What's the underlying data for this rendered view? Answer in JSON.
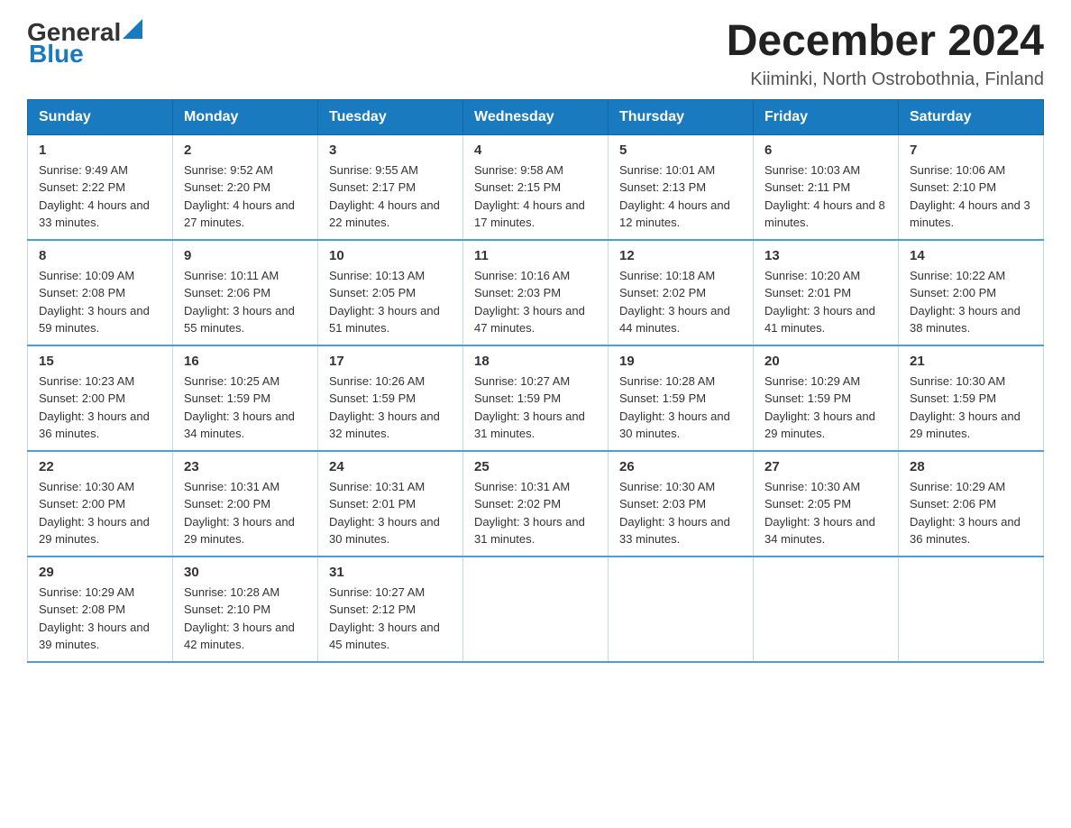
{
  "header": {
    "logo_general": "General",
    "logo_blue": "Blue",
    "title": "December 2024",
    "subtitle": "Kiiminki, North Ostrobothnia, Finland"
  },
  "days_of_week": [
    "Sunday",
    "Monday",
    "Tuesday",
    "Wednesday",
    "Thursday",
    "Friday",
    "Saturday"
  ],
  "weeks": [
    [
      {
        "day": "1",
        "sunrise": "9:49 AM",
        "sunset": "2:22 PM",
        "daylight": "4 hours and 33 minutes."
      },
      {
        "day": "2",
        "sunrise": "9:52 AM",
        "sunset": "2:20 PM",
        "daylight": "4 hours and 27 minutes."
      },
      {
        "day": "3",
        "sunrise": "9:55 AM",
        "sunset": "2:17 PM",
        "daylight": "4 hours and 22 minutes."
      },
      {
        "day": "4",
        "sunrise": "9:58 AM",
        "sunset": "2:15 PM",
        "daylight": "4 hours and 17 minutes."
      },
      {
        "day": "5",
        "sunrise": "10:01 AM",
        "sunset": "2:13 PM",
        "daylight": "4 hours and 12 minutes."
      },
      {
        "day": "6",
        "sunrise": "10:03 AM",
        "sunset": "2:11 PM",
        "daylight": "4 hours and 8 minutes."
      },
      {
        "day": "7",
        "sunrise": "10:06 AM",
        "sunset": "2:10 PM",
        "daylight": "4 hours and 3 minutes."
      }
    ],
    [
      {
        "day": "8",
        "sunrise": "10:09 AM",
        "sunset": "2:08 PM",
        "daylight": "3 hours and 59 minutes."
      },
      {
        "day": "9",
        "sunrise": "10:11 AM",
        "sunset": "2:06 PM",
        "daylight": "3 hours and 55 minutes."
      },
      {
        "day": "10",
        "sunrise": "10:13 AM",
        "sunset": "2:05 PM",
        "daylight": "3 hours and 51 minutes."
      },
      {
        "day": "11",
        "sunrise": "10:16 AM",
        "sunset": "2:03 PM",
        "daylight": "3 hours and 47 minutes."
      },
      {
        "day": "12",
        "sunrise": "10:18 AM",
        "sunset": "2:02 PM",
        "daylight": "3 hours and 44 minutes."
      },
      {
        "day": "13",
        "sunrise": "10:20 AM",
        "sunset": "2:01 PM",
        "daylight": "3 hours and 41 minutes."
      },
      {
        "day": "14",
        "sunrise": "10:22 AM",
        "sunset": "2:00 PM",
        "daylight": "3 hours and 38 minutes."
      }
    ],
    [
      {
        "day": "15",
        "sunrise": "10:23 AM",
        "sunset": "2:00 PM",
        "daylight": "3 hours and 36 minutes."
      },
      {
        "day": "16",
        "sunrise": "10:25 AM",
        "sunset": "1:59 PM",
        "daylight": "3 hours and 34 minutes."
      },
      {
        "day": "17",
        "sunrise": "10:26 AM",
        "sunset": "1:59 PM",
        "daylight": "3 hours and 32 minutes."
      },
      {
        "day": "18",
        "sunrise": "10:27 AM",
        "sunset": "1:59 PM",
        "daylight": "3 hours and 31 minutes."
      },
      {
        "day": "19",
        "sunrise": "10:28 AM",
        "sunset": "1:59 PM",
        "daylight": "3 hours and 30 minutes."
      },
      {
        "day": "20",
        "sunrise": "10:29 AM",
        "sunset": "1:59 PM",
        "daylight": "3 hours and 29 minutes."
      },
      {
        "day": "21",
        "sunrise": "10:30 AM",
        "sunset": "1:59 PM",
        "daylight": "3 hours and 29 minutes."
      }
    ],
    [
      {
        "day": "22",
        "sunrise": "10:30 AM",
        "sunset": "2:00 PM",
        "daylight": "3 hours and 29 minutes."
      },
      {
        "day": "23",
        "sunrise": "10:31 AM",
        "sunset": "2:00 PM",
        "daylight": "3 hours and 29 minutes."
      },
      {
        "day": "24",
        "sunrise": "10:31 AM",
        "sunset": "2:01 PM",
        "daylight": "3 hours and 30 minutes."
      },
      {
        "day": "25",
        "sunrise": "10:31 AM",
        "sunset": "2:02 PM",
        "daylight": "3 hours and 31 minutes."
      },
      {
        "day": "26",
        "sunrise": "10:30 AM",
        "sunset": "2:03 PM",
        "daylight": "3 hours and 33 minutes."
      },
      {
        "day": "27",
        "sunrise": "10:30 AM",
        "sunset": "2:05 PM",
        "daylight": "3 hours and 34 minutes."
      },
      {
        "day": "28",
        "sunrise": "10:29 AM",
        "sunset": "2:06 PM",
        "daylight": "3 hours and 36 minutes."
      }
    ],
    [
      {
        "day": "29",
        "sunrise": "10:29 AM",
        "sunset": "2:08 PM",
        "daylight": "3 hours and 39 minutes."
      },
      {
        "day": "30",
        "sunrise": "10:28 AM",
        "sunset": "2:10 PM",
        "daylight": "3 hours and 42 minutes."
      },
      {
        "day": "31",
        "sunrise": "10:27 AM",
        "sunset": "2:12 PM",
        "daylight": "3 hours and 45 minutes."
      },
      null,
      null,
      null,
      null
    ]
  ],
  "labels": {
    "sunrise": "Sunrise:",
    "sunset": "Sunset:",
    "daylight": "Daylight:"
  }
}
